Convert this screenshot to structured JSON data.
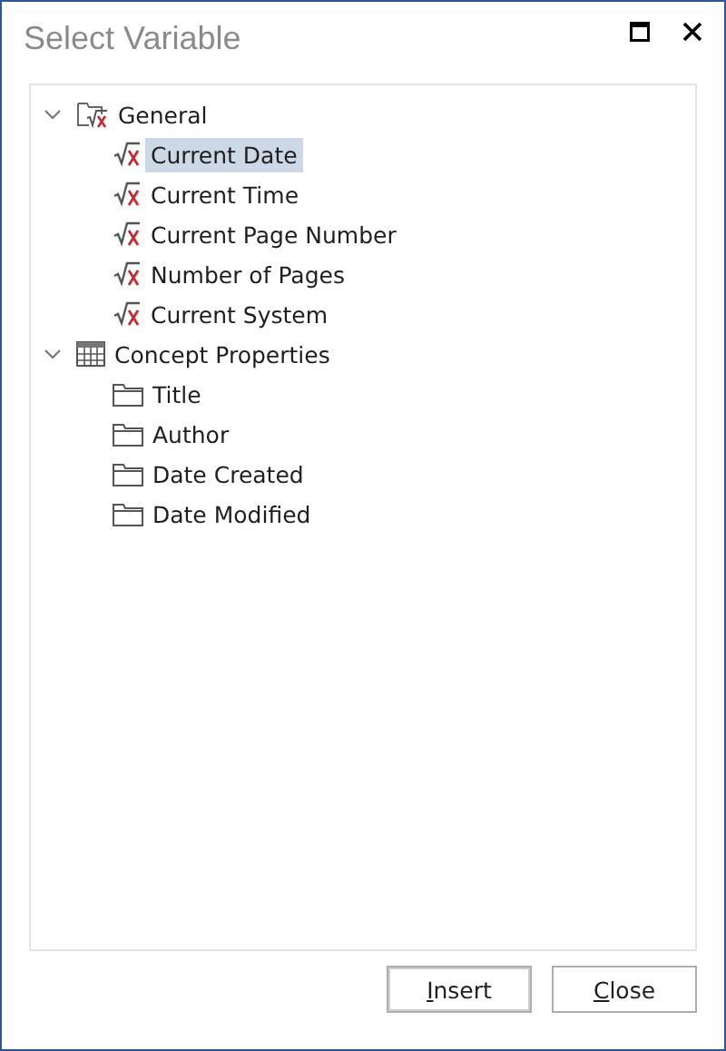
{
  "window": {
    "title": "Select Variable"
  },
  "tree": [
    {
      "label": "General",
      "kind": "variable-folder",
      "expanded": true,
      "selected": false,
      "children": [
        {
          "label": "Current Date",
          "kind": "variable",
          "selected": true
        },
        {
          "label": "Current Time",
          "kind": "variable",
          "selected": false
        },
        {
          "label": "Current Page Number",
          "kind": "variable",
          "selected": false
        },
        {
          "label": "Number of Pages",
          "kind": "variable",
          "selected": false
        },
        {
          "label": "Current System",
          "kind": "variable",
          "selected": false
        }
      ]
    },
    {
      "label": "Concept Properties",
      "kind": "table",
      "expanded": true,
      "selected": false,
      "children": [
        {
          "label": "Title",
          "kind": "folder",
          "selected": false
        },
        {
          "label": "Author",
          "kind": "folder",
          "selected": false
        },
        {
          "label": "Date Created",
          "kind": "folder",
          "selected": false
        },
        {
          "label": "Date Modified",
          "kind": "folder",
          "selected": false
        }
      ]
    }
  ],
  "buttons": [
    {
      "label": "Insert",
      "default": true,
      "mnemonic_underlined": true
    },
    {
      "label": "Close",
      "default": false,
      "mnemonic_underlined": true
    }
  ]
}
